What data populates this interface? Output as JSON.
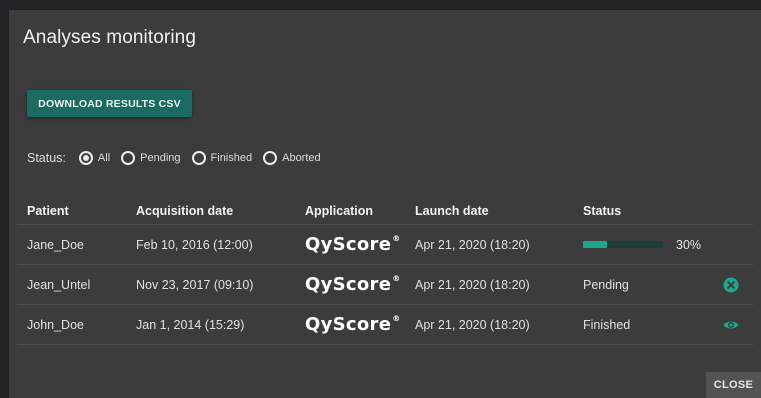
{
  "dialog": {
    "title": "Analyses monitoring",
    "download_button": "DOWNLOAD RESULTS CSV",
    "close_button": "CLOSE"
  },
  "status_filter": {
    "label": "Status:",
    "options": [
      {
        "label": "All",
        "checked": true
      },
      {
        "label": "Pending",
        "checked": false
      },
      {
        "label": "Finished",
        "checked": false
      },
      {
        "label": "Aborted",
        "checked": false
      }
    ]
  },
  "table": {
    "headers": [
      "Patient",
      "Acquisition date",
      "Application",
      "Launch date",
      "Status"
    ],
    "rows": [
      {
        "patient": "Jane_Doe",
        "acquisition": "Feb 10, 2016 (12:00)",
        "application": "QyScore",
        "app_mark": "®",
        "launch": "Apr 21, 2020 (18:20)",
        "progress": 0.3,
        "progress_label": "30%",
        "action_icon": ""
      },
      {
        "patient": "Jean_Untel",
        "acquisition": "Nov 23, 2017 (09:10)",
        "application": "QyScore",
        "app_mark": "®",
        "launch": "Apr 21, 2020 (18:20)",
        "status": "Pending",
        "action_icon": "cancel-circle-icon"
      },
      {
        "patient": "John_Doe",
        "acquisition": "Jan 1, 2014 (15:29)",
        "application": "QyScore",
        "app_mark": "®",
        "launch": "Apr 21, 2020 (18:20)",
        "status": "Finished",
        "action_icon": "eye-icon"
      }
    ]
  },
  "colors": {
    "accent": "#1fa590",
    "button": "#1b6b63",
    "background": "#3c3c3c"
  }
}
